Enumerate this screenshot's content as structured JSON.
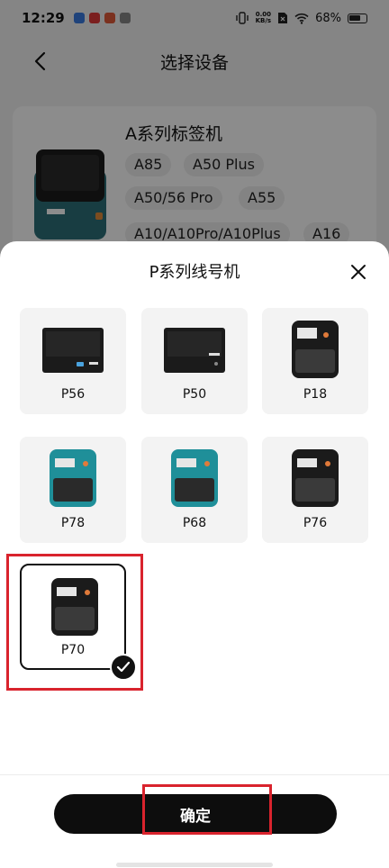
{
  "status_bar": {
    "time": "12:29",
    "net_speed_value": "0.00",
    "net_speed_unit": "KB/s",
    "battery": "68%"
  },
  "nav": {
    "title": "选择设备",
    "back_icon": "back-arrow-icon"
  },
  "background_series": {
    "title": "A系列标签机",
    "models": [
      "A85",
      "A50 Plus",
      "A50/56 Pro",
      "A55",
      "A10/A10Pro/A10Plus",
      "A16"
    ]
  },
  "sheet": {
    "title": "P系列线号机",
    "close_icon": "close-icon",
    "devices": [
      {
        "label": "P56",
        "selected": false,
        "body_color": "#1b1b1b"
      },
      {
        "label": "P50",
        "selected": false,
        "body_color": "#1b1b1b"
      },
      {
        "label": "P18",
        "selected": false,
        "body_color": "#1b1b1b"
      },
      {
        "label": "P78",
        "selected": false,
        "body_color": "#1f8f99"
      },
      {
        "label": "P68",
        "selected": false,
        "body_color": "#1f8f99"
      },
      {
        "label": "P76",
        "selected": false,
        "body_color": "#1b1b1b"
      },
      {
        "label": "P70",
        "selected": true,
        "body_color": "#1b1b1b"
      }
    ],
    "confirm_label": "确定"
  },
  "colors": {
    "accent": "#0d0d0d",
    "highlight": "#d9232d",
    "card_bg": "#f3f3f3"
  }
}
